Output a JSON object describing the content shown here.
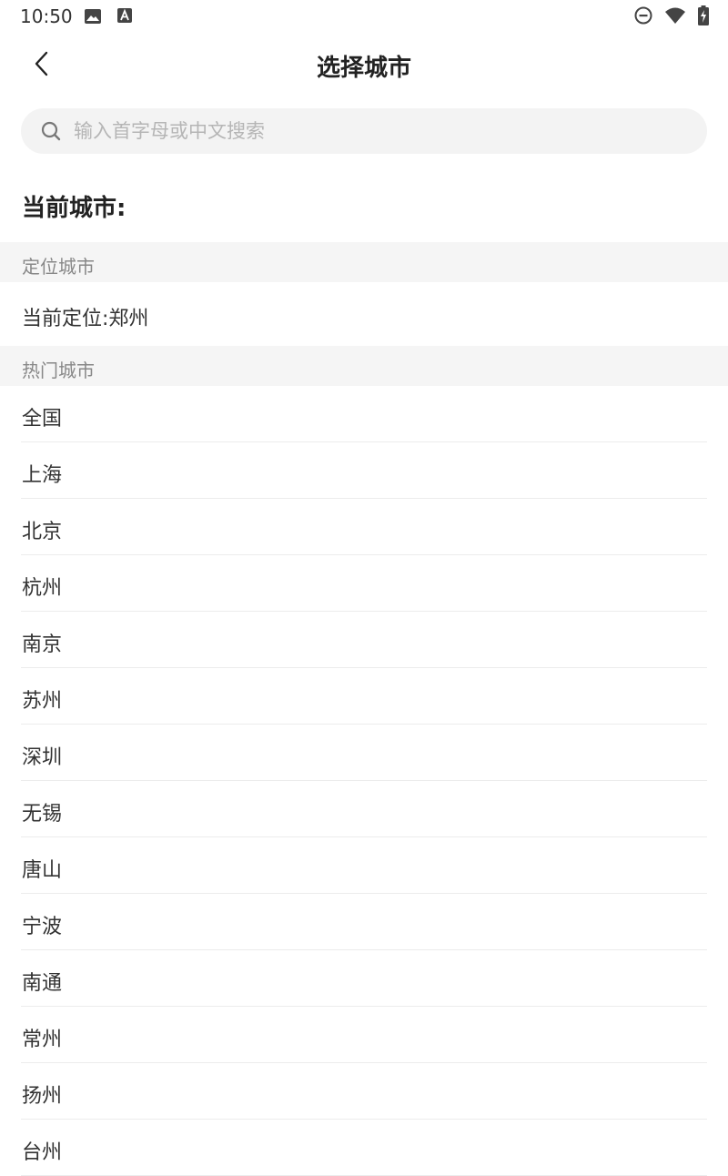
{
  "status_bar": {
    "time": "10:50"
  },
  "header": {
    "title": "选择城市"
  },
  "search": {
    "placeholder": "输入首字母或中文搜索"
  },
  "current_city_label": "当前城市:",
  "location_section": {
    "title": "定位城市",
    "located_text": "当前定位:郑州"
  },
  "hot_section": {
    "title": "热门城市",
    "cities": [
      "全国",
      "上海",
      "北京",
      "杭州",
      "南京",
      "苏州",
      "深圳",
      "无锡",
      "唐山",
      "宁波",
      "南通",
      "常州",
      "扬州",
      "台州"
    ]
  }
}
